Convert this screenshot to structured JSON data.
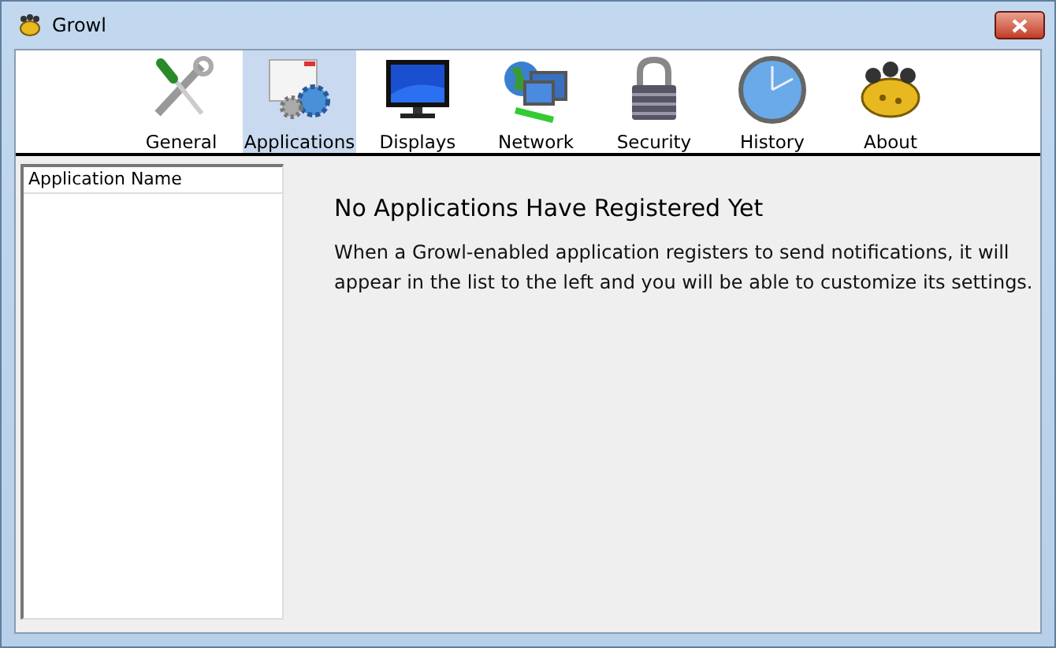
{
  "window": {
    "title": "Growl"
  },
  "tabs": [
    {
      "label": "General",
      "selected": false
    },
    {
      "label": "Applications",
      "selected": true
    },
    {
      "label": "Displays",
      "selected": false
    },
    {
      "label": "Network",
      "selected": false
    },
    {
      "label": "Security",
      "selected": false
    },
    {
      "label": "History",
      "selected": false
    },
    {
      "label": "About",
      "selected": false
    }
  ],
  "list": {
    "column": "Application Name"
  },
  "message": {
    "heading": "No Applications Have Registered Yet",
    "body": "When a Growl-enabled application registers to send notifications, it will appear in the list to the left and you will be able to customize its settings."
  }
}
